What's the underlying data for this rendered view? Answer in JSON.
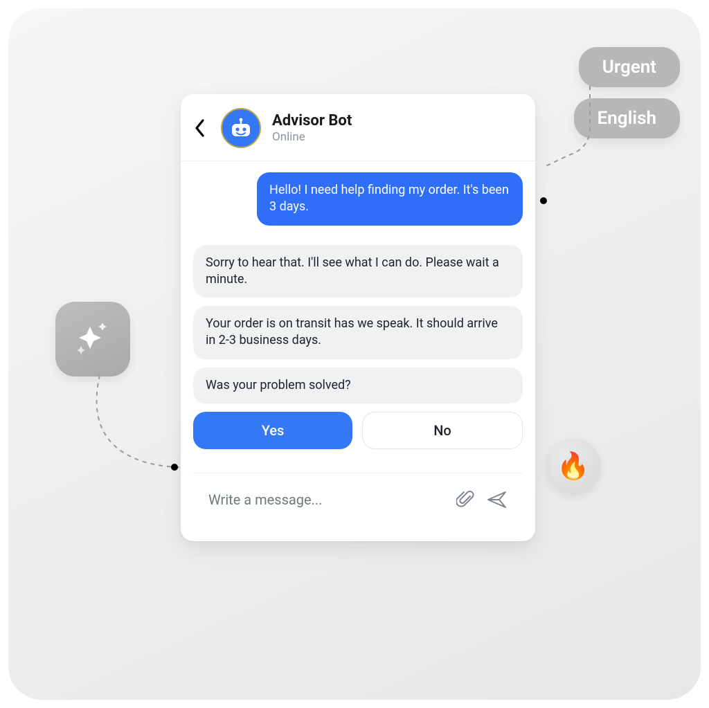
{
  "tags": {
    "urgent": "Urgent",
    "english": "English"
  },
  "chat": {
    "bot_name": "Advisor Bot",
    "bot_status": "Online",
    "messages": {
      "user_1": "Hello! I need help finding my order. It's been 3 days.",
      "bot_1": "Sorry to hear that. I'll see what I can do. Please wait a minute.",
      "bot_2": "Your order is on transit has we speak. It should arrive in 2-3 business days.",
      "bot_3": "Was your problem solved?"
    },
    "replies": {
      "yes": "Yes",
      "no": "No"
    },
    "input_placeholder": "Write a message..."
  },
  "badges": {
    "fire_emoji": "🔥"
  }
}
